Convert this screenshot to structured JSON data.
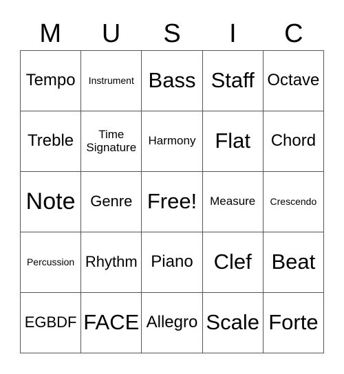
{
  "header": {
    "letters": [
      "M",
      "U",
      "S",
      "I",
      "C"
    ]
  },
  "cells": [
    [
      "Tempo",
      "Instrument",
      "Bass",
      "Staff",
      "Octave"
    ],
    [
      "Treble",
      "Time Signature",
      "Harmony",
      "Flat",
      "Chord"
    ],
    [
      "Note",
      "Genre",
      "Free!",
      "Measure",
      "Crescendo"
    ],
    [
      "Percussion",
      "Rhythm",
      "Piano",
      "Clef",
      "Beat"
    ],
    [
      "EGBDF",
      "FACE",
      "Allegro",
      "Scale",
      "Forte"
    ]
  ]
}
